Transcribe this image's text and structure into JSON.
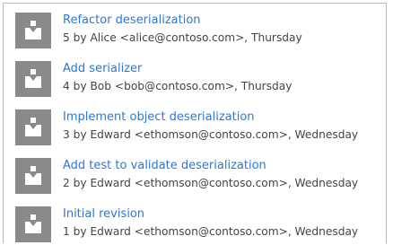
{
  "commits": [
    {
      "title": "Refactor deserialization",
      "meta": "5 by Alice <alice@contoso.com>, Thursday"
    },
    {
      "title": "Add serializer",
      "meta": "4 by Bob <bob@contoso.com>, Thursday"
    },
    {
      "title": "Implement object deserialization",
      "meta": "3 by Edward <ethomson@contoso.com>, Wednesday"
    },
    {
      "title": "Add test to validate deserialization",
      "meta": "2 by Edward <ethomson@contoso.com>, Wednesday"
    },
    {
      "title": "Initial revision",
      "meta": "1 by Edward <ethomson@contoso.com>, Wednesday"
    }
  ],
  "colors": {
    "avatar_bg": "#8a8a8a",
    "link": "#2b79d6",
    "meta_text": "#444444",
    "border": "#b9b9b9"
  },
  "icons": {
    "avatar": "user-placeholder-icon"
  }
}
